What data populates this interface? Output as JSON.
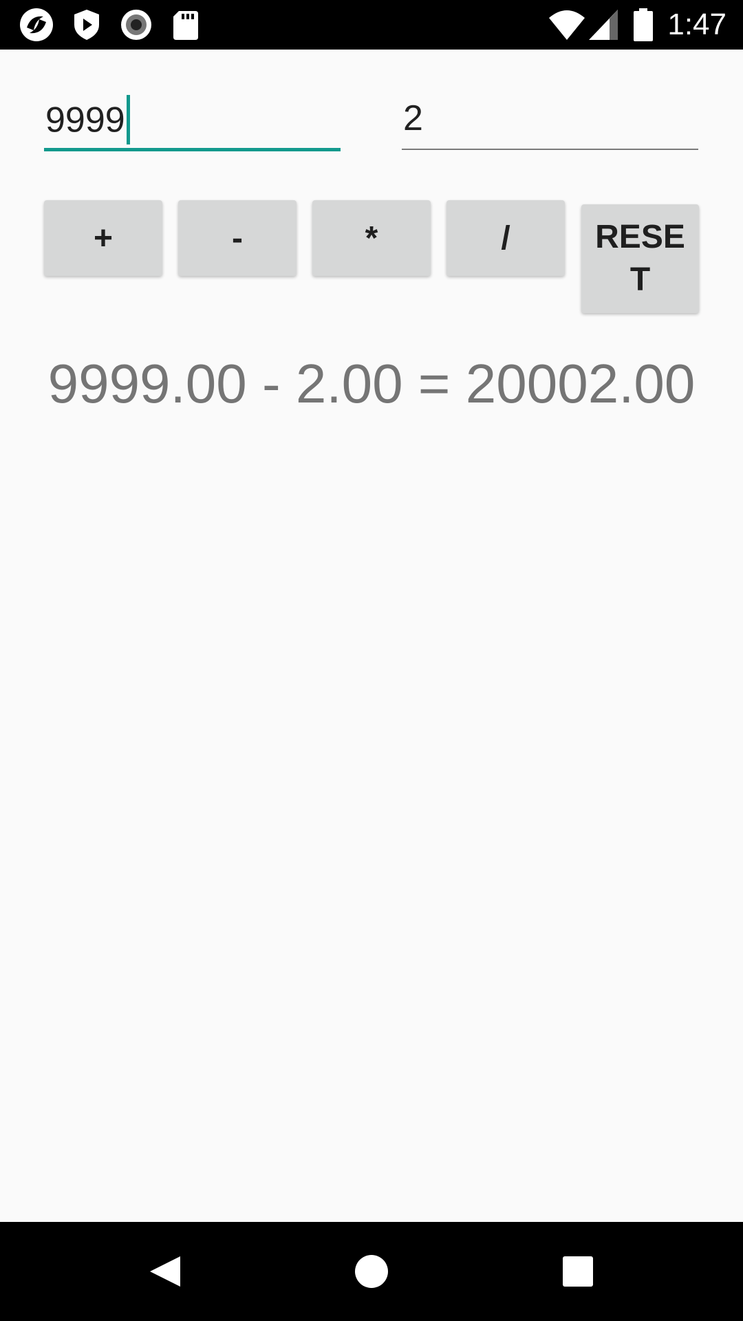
{
  "status_bar": {
    "time": "1:47",
    "left_icons": [
      "app-logo-icon",
      "shield-play-icon",
      "record-icon",
      "sd-card-icon"
    ],
    "right_icons": [
      "wifi-icon",
      "cell-signal-icon",
      "battery-icon"
    ]
  },
  "inputs": {
    "first": {
      "value": "9999",
      "focused": true
    },
    "second": {
      "value": "2",
      "focused": false
    }
  },
  "buttons": {
    "add": "+",
    "subtract": "-",
    "multiply": "*",
    "divide": "/",
    "reset": "RESET"
  },
  "result": "9999.00 - 2.00 = 20002.00",
  "nav_bar": {
    "icons": [
      "back-icon",
      "home-icon",
      "recents-icon"
    ]
  },
  "colors": {
    "accent": "#12998d",
    "background": "#fafafa",
    "button": "#d6d7d7",
    "result_text": "#757575"
  }
}
